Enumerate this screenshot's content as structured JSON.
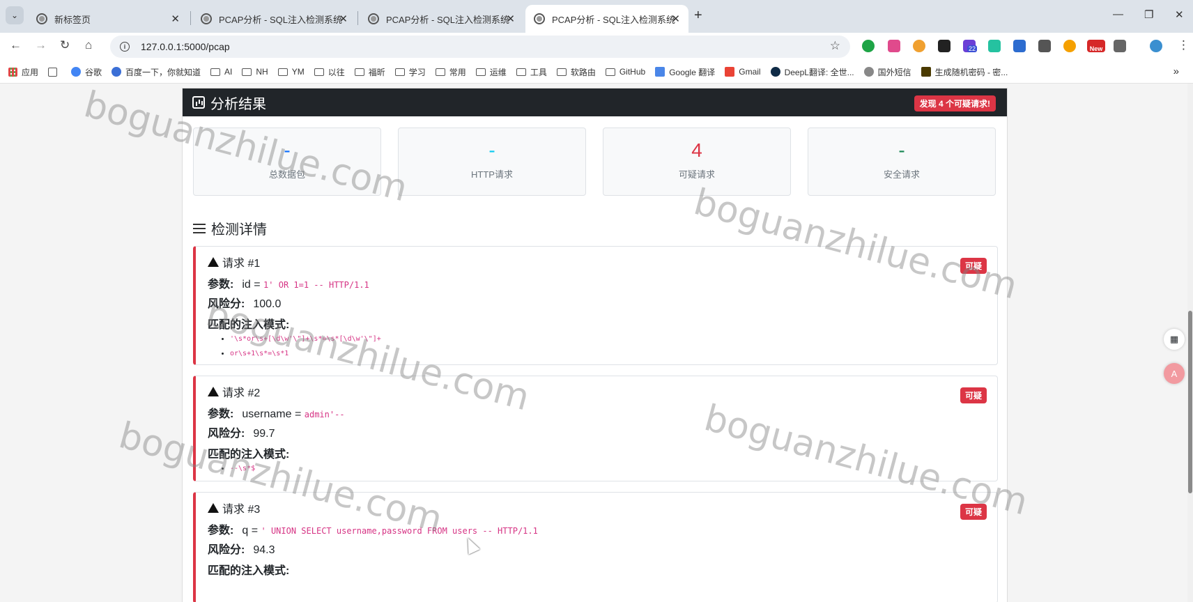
{
  "browser": {
    "tabs": [
      {
        "title": "新标签页"
      },
      {
        "title": "PCAP分析 - SQL注入检测系统"
      },
      {
        "title": "PCAP分析 - SQL注入检测系统"
      },
      {
        "title": "PCAP分析 - SQL注入检测系统"
      }
    ],
    "active_tab": 3,
    "url": "127.0.0.1:5000/pcap",
    "bookmarks": [
      "应用",
      "谷歌",
      "百度一下，你就知道",
      "AI",
      "NH",
      "YM",
      "以往",
      "福昕",
      "学习",
      "常用",
      "运维",
      "工具",
      "软路由",
      "GitHub",
      "Google 翻译",
      "Gmail",
      "DeepL翻译: 全世...",
      "国外短信",
      "生成随机密码 - 密..."
    ],
    "ext_badges": {
      "count": "22",
      "new": "New"
    }
  },
  "page": {
    "header_title": "分析结果",
    "alert_badge": "发现 4 个可疑请求!",
    "stats": [
      {
        "value": "-",
        "label": "总数据包",
        "color": "#0d6efd"
      },
      {
        "value": "-",
        "label": "HTTP请求",
        "color": "#0dcaf0"
      },
      {
        "value": "4",
        "label": "可疑请求",
        "color": "#dc3545"
      },
      {
        "value": "-",
        "label": "安全请求",
        "color": "#198754"
      }
    ],
    "section_title": "检测详情",
    "labels": {
      "param": "参数:",
      "risk": "风险分:",
      "patterns": "匹配的注入模式:",
      "suspicious": "可疑"
    },
    "requests": [
      {
        "title": "请求 #1",
        "param_name": "id",
        "eq": "=",
        "param_value": "1' OR 1=1 -- HTTP/1.1",
        "risk": "100.0",
        "patterns": [
          "'\\s*or\\s+[\\d\\w'\\\"]+\\s*=\\s*[\\d\\w'\\\"]+",
          "or\\s+1\\s*=\\s*1"
        ]
      },
      {
        "title": "请求 #2",
        "param_name": "username",
        "eq": "=",
        "param_value": "admin'--",
        "risk": "99.7",
        "patterns": [
          "--\\s*$"
        ]
      },
      {
        "title": "请求 #3",
        "param_name": "q",
        "eq": "=",
        "param_value": "' UNION SELECT username,password FROM users -- HTTP/1.1",
        "risk": "94.3",
        "patterns": []
      }
    ],
    "watermark": "boguanzhilue.com"
  }
}
